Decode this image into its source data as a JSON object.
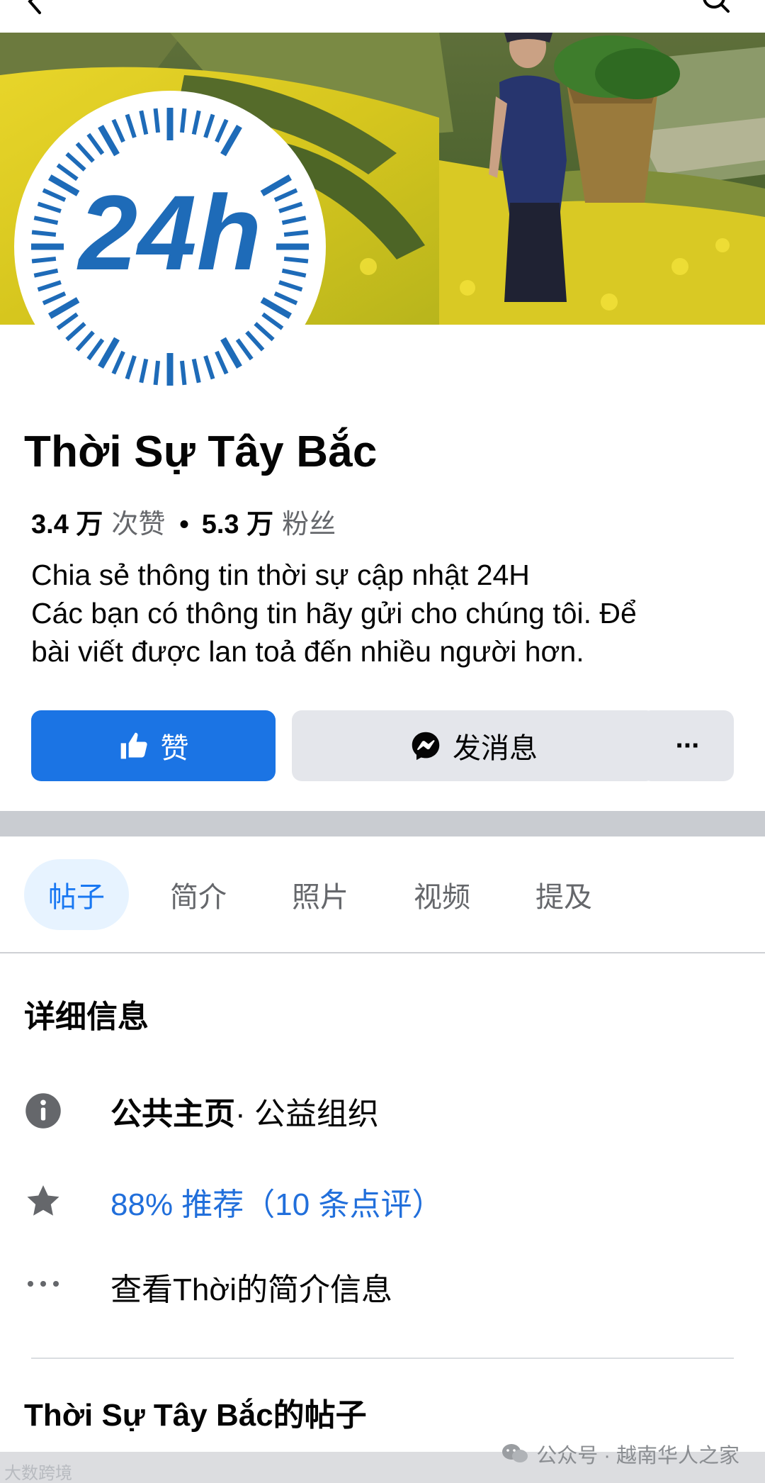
{
  "page": {
    "name": "Thời Sự Tây Bắc",
    "likes_count": "3.4 万",
    "likes_label": "次赞",
    "followers_count": "5.3 万",
    "followers_label": "粉丝",
    "bio_lines": [
      "Chia sẻ thông tin thời sự cập nhật 24H",
      "Các bạn có thông tin hãy gửi cho chúng tôi. Để",
      "bài viết được lan toả đến nhiều người hơn."
    ]
  },
  "avatar": {
    "text": "24h",
    "color": "#1e6bb8"
  },
  "actions": {
    "like_label": "赞",
    "message_label": "发消息",
    "more_label": "···"
  },
  "tabs": [
    {
      "label": "帖子",
      "active": true
    },
    {
      "label": "简介",
      "active": false
    },
    {
      "label": "照片",
      "active": false
    },
    {
      "label": "视频",
      "active": false
    },
    {
      "label": "提及",
      "active": false
    }
  ],
  "details": {
    "title": "详细信息",
    "category_bold": "公共主页",
    "category_rest": " · 公益组织",
    "rating": "88% 推荐（10 条点评）",
    "see_about": "查看Thời的简介信息"
  },
  "posts_section": {
    "title": "Thời Sự Tây Bắc的帖子"
  },
  "watermarks": {
    "right": "公众号 · 越南华人之家",
    "left": "大数跨境"
  },
  "colors": {
    "primary": "#1b74e4",
    "secondary_button": "#e4e6eb",
    "active_tab_bg": "#e7f3ff",
    "active_tab_text": "#1877f2",
    "link_blue": "#216fdb",
    "muted_text": "#65676b"
  },
  "icons": {
    "back": "back-arrow-icon",
    "search": "search-icon",
    "like": "thumbs-up-icon",
    "message": "messenger-icon",
    "info": "info-icon",
    "rating": "star-icon",
    "more": "ellipsis-icon",
    "watermark": "wechat-icon"
  }
}
